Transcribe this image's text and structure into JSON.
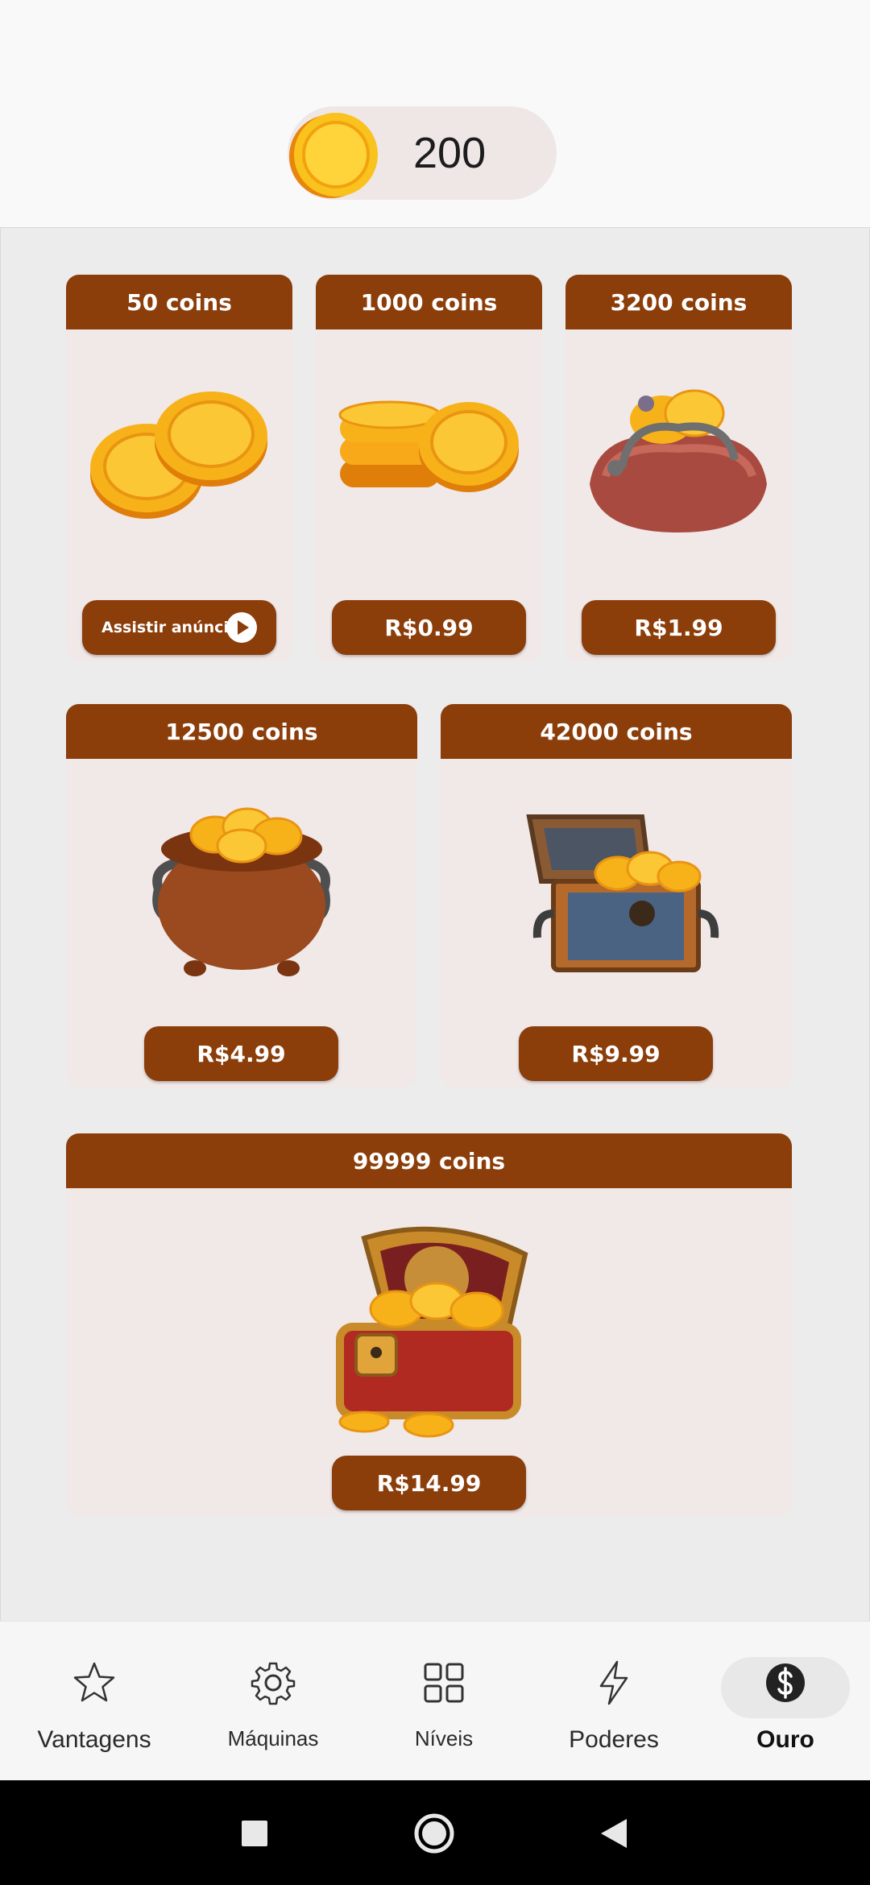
{
  "balance": {
    "coins": "200"
  },
  "packs": [
    {
      "amount": "50 coins",
      "action": "Assistir anúncio"
    },
    {
      "amount": "1000 coins",
      "price": "R$0.99"
    },
    {
      "amount": "3200 coins",
      "price": "R$1.99"
    },
    {
      "amount": "12500 coins",
      "price": "R$4.99"
    },
    {
      "amount": "42000 coins",
      "price": "R$9.99"
    },
    {
      "amount": "99999 coins",
      "price": "R$14.99"
    }
  ],
  "nav": [
    {
      "label": "Vantagens",
      "icon": "star-icon"
    },
    {
      "label": "Máquinas",
      "icon": "gear-icon"
    },
    {
      "label": "Níveis",
      "icon": "grid-icon"
    },
    {
      "label": "Poderes",
      "icon": "lightning-icon"
    },
    {
      "label": "Ouro",
      "icon": "dollar-icon",
      "active": true
    }
  ],
  "system_nav": [
    "recents-button",
    "home-button",
    "back-button"
  ],
  "colors": {
    "accent": "#8b3d0a",
    "card_bg": "#f1e8e8",
    "gold": "#f7b21a"
  }
}
